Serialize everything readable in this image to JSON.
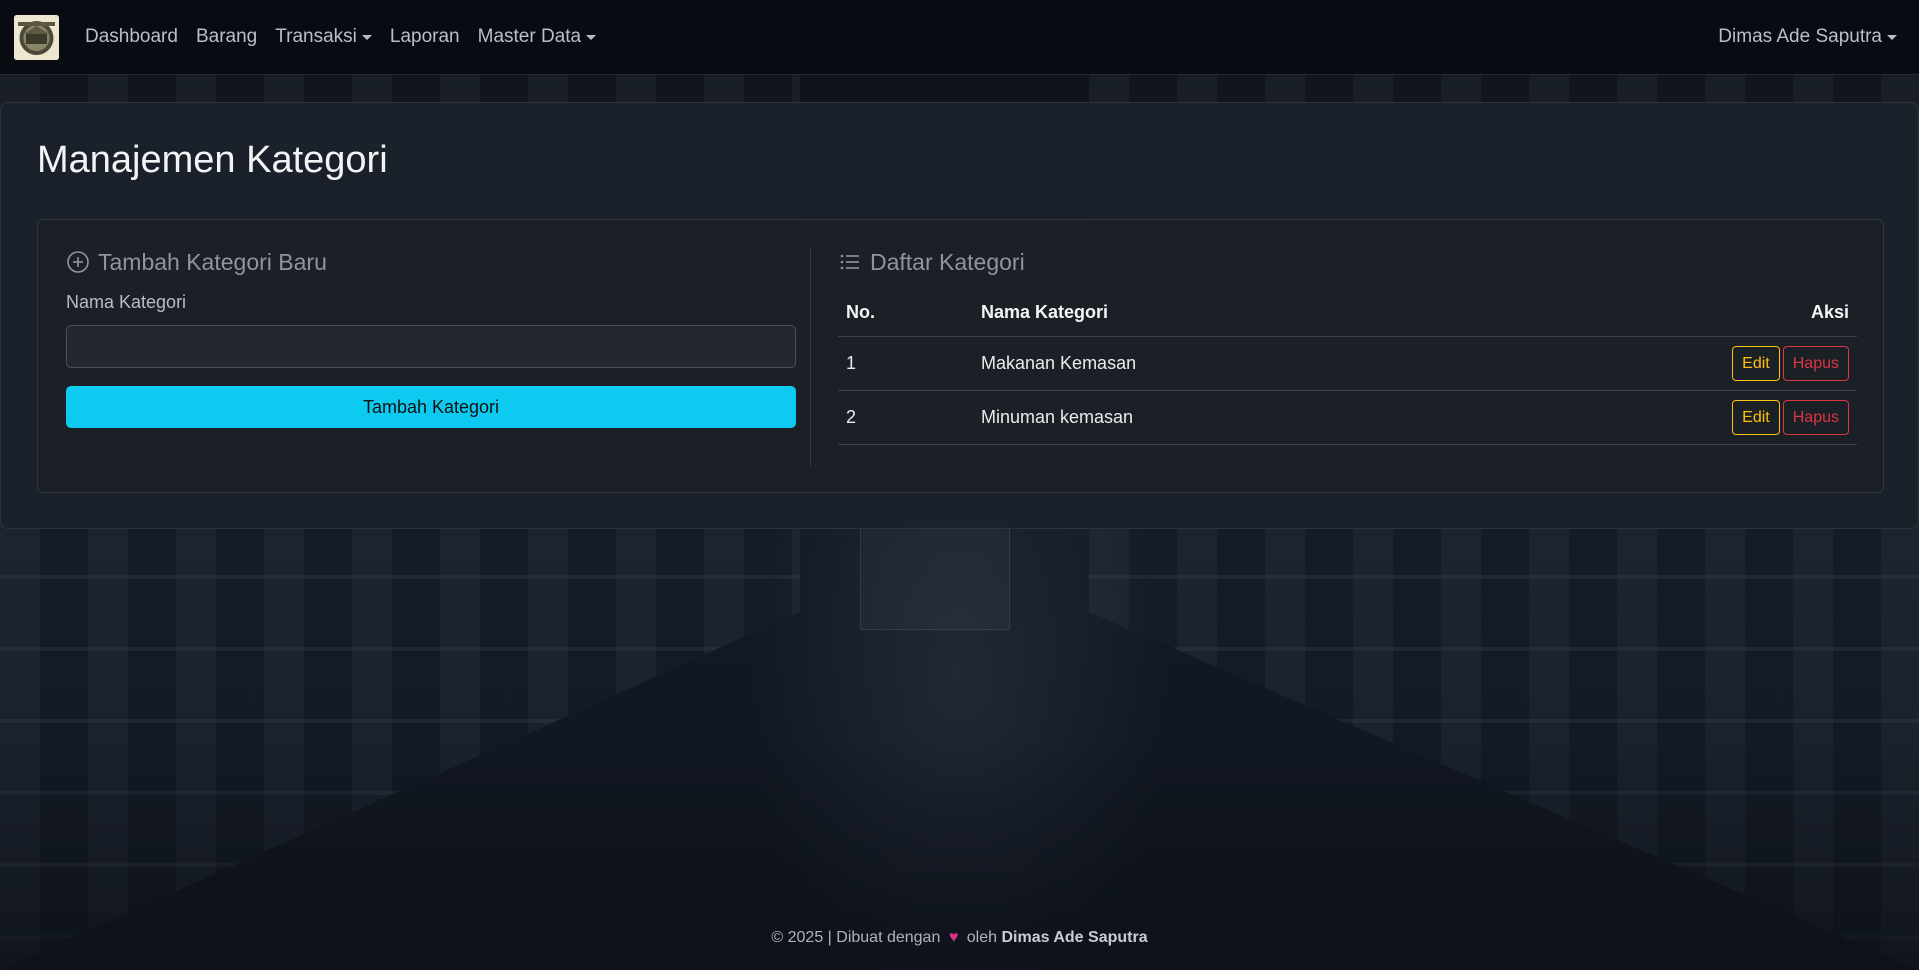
{
  "navbar": {
    "items": [
      {
        "label": "Dashboard"
      },
      {
        "label": "Barang"
      },
      {
        "label": "Transaksi",
        "dropdown": true
      },
      {
        "label": "Laporan"
      },
      {
        "label": "Master Data",
        "dropdown": true
      }
    ],
    "user": "Dimas Ade Saputra"
  },
  "page": {
    "title": "Manajemen Kategori"
  },
  "form": {
    "title": "Tambah Kategori Baru",
    "field_label": "Nama Kategori",
    "field_value": "",
    "submit_label": "Tambah Kategori"
  },
  "list": {
    "title": "Daftar Kategori",
    "columns": [
      "No.",
      "Nama Kategori",
      "Aksi"
    ],
    "rows": [
      {
        "no": "1",
        "name": "Makanan Kemasan",
        "edit": "Edit",
        "delete": "Hapus"
      },
      {
        "no": "2",
        "name": "Minuman kemasan",
        "edit": "Edit",
        "delete": "Hapus"
      }
    ]
  },
  "footer": {
    "prefix": "© 2025 | Dibuat dengan",
    "middle": "oleh",
    "author": "Dimas Ade Saputra"
  },
  "colors": {
    "accent": "#0dcaf0",
    "edit": "#ffc107",
    "delete": "#dc3545",
    "heart": "#d63384"
  },
  "icons": {
    "add_section": "plus-circle-icon",
    "list_section": "list-icon",
    "footer_heart": "heart-icon"
  }
}
